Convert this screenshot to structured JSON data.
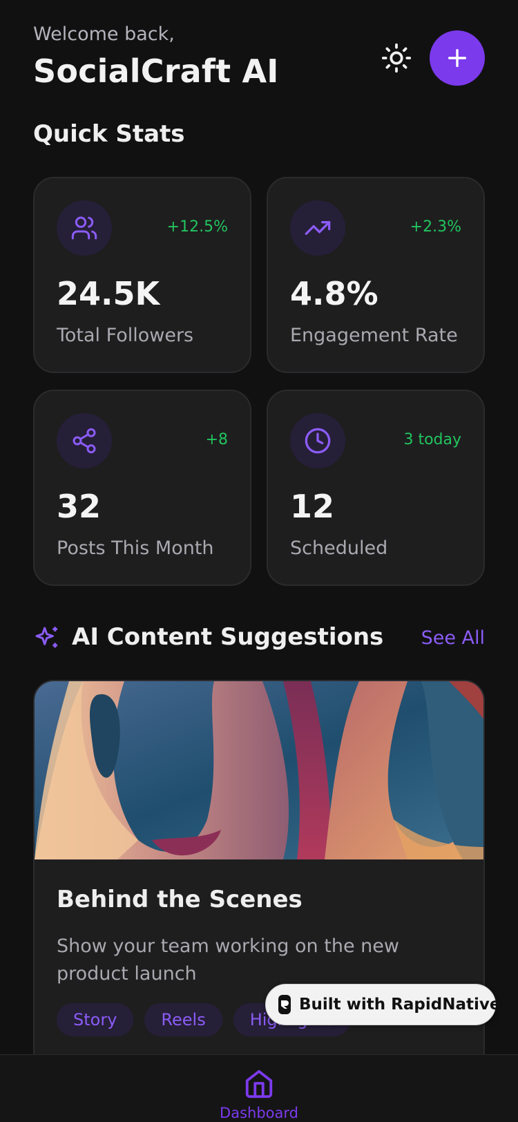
{
  "header": {
    "welcome": "Welcome back,",
    "title": "SocialCraft AI",
    "theme_icon": "sun-icon",
    "add_icon": "plus-icon"
  },
  "quick_stats": {
    "title": "Quick Stats",
    "cards": [
      {
        "icon": "users-icon",
        "change": "+12.5%",
        "value": "24.5K",
        "label": "Total Followers"
      },
      {
        "icon": "trending-up-icon",
        "change": "+2.3%",
        "value": "4.8%",
        "label": "Engagement Rate"
      },
      {
        "icon": "share-icon",
        "change": "+8",
        "value": "32",
        "label": "Posts This Month"
      },
      {
        "icon": "clock-icon",
        "change": "3 today",
        "value": "12",
        "label": "Scheduled"
      }
    ]
  },
  "suggestions": {
    "title": "AI Content Suggestions",
    "see_all": "See All",
    "icon": "sparkles-icon",
    "card": {
      "title": "Behind the Scenes",
      "description": "Show your team working on the new product launch",
      "tags": [
        "Story",
        "Reels",
        "Highlights"
      ]
    }
  },
  "badge": {
    "text": "Built with RapidNative"
  },
  "nav": {
    "items": [
      {
        "label": "Dashboard",
        "icon": "home-icon"
      }
    ]
  },
  "colors": {
    "accent": "#7c3aed",
    "positive": "#22c55e",
    "background": "#111112",
    "card": "#1e1e1f"
  }
}
